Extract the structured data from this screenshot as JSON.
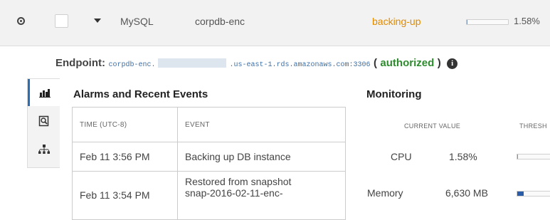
{
  "instance_row": {
    "engine": "MySQL",
    "identifier": "corpdb-enc",
    "status": "backing-up",
    "status_color": "#e08a00",
    "cpu_utilization_percent": 1.58,
    "cpu_label": "1.58%"
  },
  "endpoint": {
    "label": "Endpoint:",
    "host_prefix": "corpdb-enc.",
    "host_suffix": ".us-east-1.rds.amazonaws.com:3306",
    "open_paren": "(",
    "status": "authorized",
    "close_paren": ")",
    "status_color": "#2e8b2e",
    "info_icon": "info-icon",
    "info_glyph": "i"
  },
  "tabs": [
    {
      "icon": "bar-chart-icon",
      "active": true
    },
    {
      "icon": "search-log-icon",
      "active": false
    },
    {
      "icon": "hierarchy-icon",
      "active": false
    }
  ],
  "alarms": {
    "title": "Alarms and Recent Events",
    "headers": [
      "TIME (UTC-8)",
      "EVENT"
    ],
    "rows": [
      {
        "time": "Feb 11 3:56 PM",
        "event": "Backing up DB instance"
      },
      {
        "time": "Feb 11 3:54 PM",
        "event_line1": "Restored from snapshot",
        "event_line2": "snap-2016-02-11-enc-"
      }
    ]
  },
  "monitoring": {
    "title": "Monitoring",
    "headers": [
      "CURRENT VALUE",
      "THRESH"
    ],
    "metrics": [
      {
        "name": "CPU",
        "value": "1.58%",
        "level_percent": 1.58
      },
      {
        "name": "Memory",
        "value": "6,630 MB",
        "level_percent": 18
      }
    ]
  }
}
